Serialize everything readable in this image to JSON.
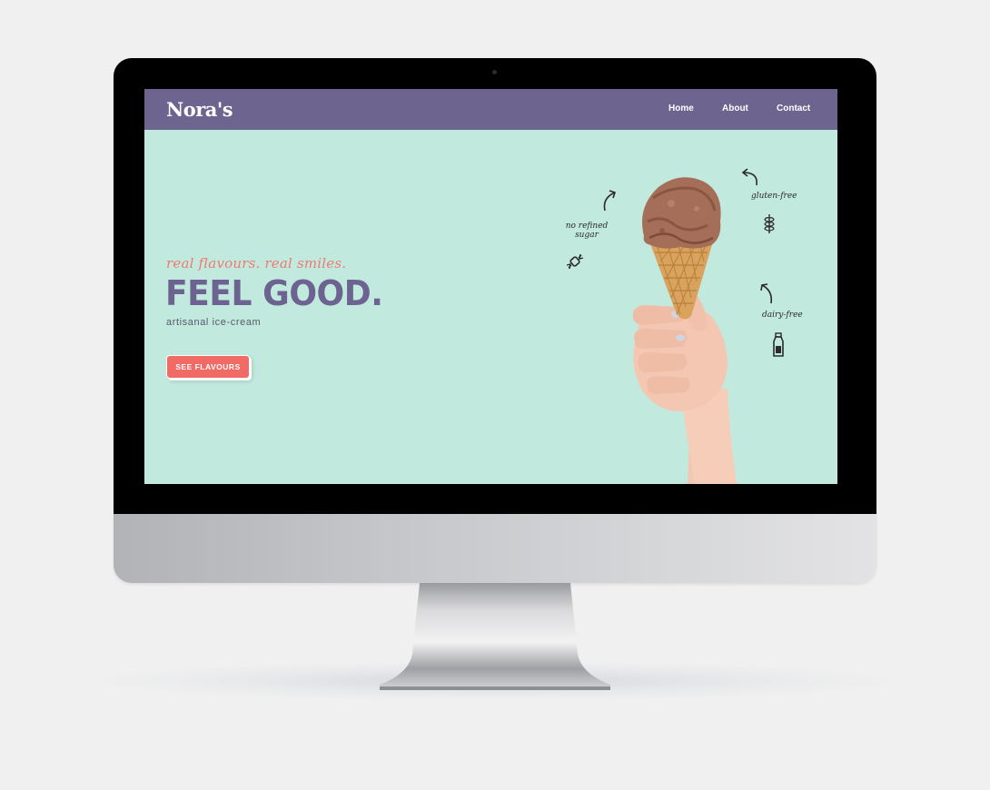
{
  "site": {
    "logo": "Nora's",
    "nav": {
      "home": "Home",
      "about": "About",
      "contact": "Contact"
    }
  },
  "hero": {
    "tagline": "real flavours. real smiles.",
    "headline": "FEEL GOOD.",
    "subline": "artisanal ice-cream",
    "cta_label": "SEE FLAVOURS"
  },
  "annotations": {
    "gluten_free": "gluten-free",
    "no_refined_sugar": "no refined sugar",
    "dairy_free": "dairy-free"
  },
  "icons": {
    "gluten": "wheat-icon",
    "sugar": "candy-icon",
    "dairy": "milk-bottle-icon",
    "arrows": "curved-arrow-icon"
  },
  "colors": {
    "nav_bg": "#6d648f",
    "hero_bg": "#c2e9de",
    "headline": "#6c6390",
    "accent": "#f06b66",
    "tagline": "#ee7a72"
  }
}
